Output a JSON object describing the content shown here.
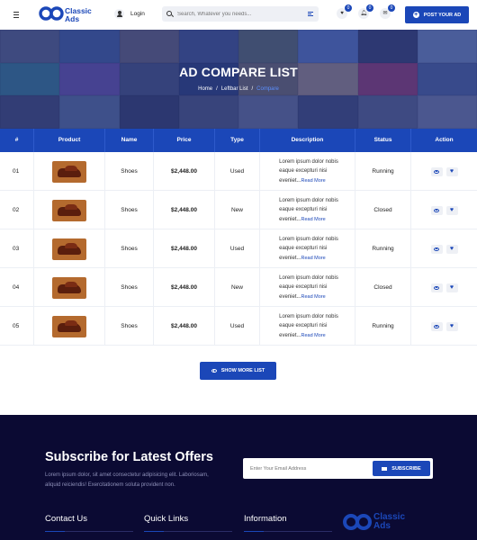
{
  "header": {
    "logo_line1": "Classic",
    "logo_line2": "Ads",
    "login_label": "Login",
    "search_placeholder": "Search, Whatever you needs...",
    "favorites_count": "0",
    "notifications_count": "0",
    "messages_count": "0",
    "post_button": "POST YOUR AD"
  },
  "hero": {
    "title": "AD COMPARE LIST",
    "breadcrumb": [
      "Home",
      "Leftbar List",
      "Compare"
    ]
  },
  "table": {
    "columns": [
      "#",
      "Product",
      "Name",
      "Price",
      "Type",
      "Description",
      "Status",
      "Action"
    ],
    "rows": [
      {
        "num": "01",
        "name": "Shoes",
        "price": "$2,448.00",
        "type": "Used",
        "desc1": "Lorem ipsum dolor nobis",
        "desc2": "eaque excepturi nisi",
        "desc3": "eveniet...",
        "read_more": "Read More",
        "status": "Running"
      },
      {
        "num": "02",
        "name": "Shoes",
        "price": "$2,448.00",
        "type": "New",
        "desc1": "Lorem ipsum dolor nobis",
        "desc2": "eaque excepturi nisi",
        "desc3": "eveniet...",
        "read_more": "Read More",
        "status": "Closed"
      },
      {
        "num": "03",
        "name": "Shoes",
        "price": "$2,448.00",
        "type": "Used",
        "desc1": "Lorem ipsum dolor nobis",
        "desc2": "eaque excepturi nisi",
        "desc3": "eveniet...",
        "read_more": "Read More",
        "status": "Running"
      },
      {
        "num": "04",
        "name": "Shoes",
        "price": "$2,448.00",
        "type": "New",
        "desc1": "Lorem ipsum dolor nobis",
        "desc2": "eaque excepturi nisi",
        "desc3": "eveniet...",
        "read_more": "Read More",
        "status": "Closed"
      },
      {
        "num": "05",
        "name": "Shoes",
        "price": "$2,448.00",
        "type": "Used",
        "desc1": "Lorem ipsum dolor nobis",
        "desc2": "eaque excepturi nisi",
        "desc3": "eveniet...",
        "read_more": "Read More",
        "status": "Running"
      }
    ]
  },
  "show_more": "SHOW MORE LIST",
  "footer": {
    "subscribe_title": "Subscribe for Latest Offers",
    "subscribe_text_1": "Lorem ipsum dolor, sit amet consectetur adipisicing elit. Laboriosam,",
    "subscribe_text_2": "aliquid reiciendis! Exercitationem soluta provident non.",
    "email_placeholder": "Enter Your Email Address",
    "subscribe_button": "SUBSCRIBE",
    "col1": "Contact Us",
    "col2": "Quick Links",
    "col3": "Information",
    "logo_line1": "Classic",
    "logo_line2": "Ads"
  },
  "colors": {
    "brand": "#1b47b8",
    "footer_bg": "#0b0a33",
    "hero_overlay": "#243482"
  }
}
